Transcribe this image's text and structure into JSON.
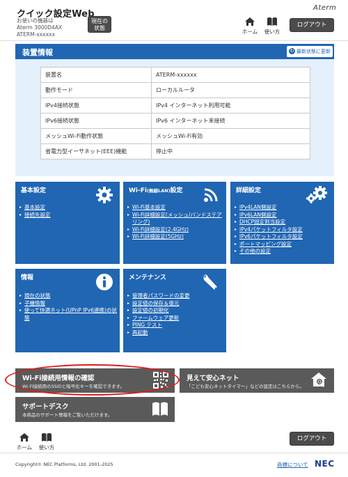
{
  "header": {
    "app_title": "クイック設定Web",
    "model_line1": "お使いの機器は",
    "model_line2": "Aterm 3000D4AX",
    "model_line3": "ATERM-xxxxxx",
    "status_button_line1": "現在の",
    "status_button_line2": "状態",
    "home_label": "ホーム",
    "help_label": "使い方",
    "logout_label": "ログアウト",
    "brand": "Aterm"
  },
  "device_panel": {
    "title": "装置情報",
    "refresh_label": "最新状態に更新",
    "rows": [
      {
        "key": "装置名",
        "value": "ATERM-xxxxxx"
      },
      {
        "key": "動作モード",
        "value": "ローカルルータ"
      },
      {
        "key": "IPv4接続状態",
        "value": "IPv4 インターネット利用可能"
      },
      {
        "key": "IPv6接続状態",
        "value": "IPv6 インターネット未接続"
      },
      {
        "key": "メッシュWi-Fi動作状態",
        "value": "メッシュWi-Fi有効"
      },
      {
        "key": "省電力型イーサネット(EEE)機能",
        "value": "停止中"
      }
    ]
  },
  "tiles": {
    "basic": {
      "title": "基本設定",
      "icon": "gear-icon",
      "links": [
        "基本設定",
        "接続先設定"
      ]
    },
    "wifi": {
      "title": "Wi-Fi",
      "title_small": "(無線LAN)",
      "title_suffix": "設定",
      "icon": "wifi-icon",
      "links": [
        "Wi-Fi基本設定",
        "Wi-Fi詳細設定(メッシュ/バンドステアリング)",
        "Wi-Fi詳細設定(2.4GHz)",
        "Wi-Fi詳細設定(5GHz)"
      ]
    },
    "advanced": {
      "title": "詳細設定",
      "icon": "gears-icon",
      "links": [
        "IPv4LAN側設定",
        "IPv6LAN側設定",
        "DHCP固定割当設定",
        "IPv4パケットフィルタ設定",
        "IPv6パケットフィルタ設定",
        "ポートマッピング設定",
        "その他の設定"
      ]
    },
    "info": {
      "title": "情報",
      "icon": "info-icon",
      "links": [
        "現在の状態",
        "子機情報",
        "使って快適ネット(UPnP IPv6連携)の状態"
      ]
    },
    "maintenance": {
      "title": "メンテナンス",
      "icon": "wrench-icon",
      "links": [
        "管理者パスワードの変更",
        "設定値の保存＆復元",
        "設定値の初期化",
        "ファームウェア更新",
        "PING テスト",
        "再起動"
      ]
    }
  },
  "bottom_tiles": {
    "wifi_confirm": {
      "title": "Wi-Fi接続用情報の確認",
      "subtitle": "Wi-Fi接続用のSSIDと暗号化キーを確認できます。",
      "icon": "qr-code-icon"
    },
    "safe_net": {
      "title": "見えて安心ネット",
      "subtitle": "「こども安心ネットタイマー」などの設定はこちらから。",
      "icon": "house-search-icon"
    },
    "support": {
      "title": "サポートデスク",
      "subtitle": "本商品のサポート情報をご覧いただけます。",
      "icon": "book-icon"
    }
  },
  "footer": {
    "home_label": "ホーム",
    "help_label": "使い方",
    "logout_label": "ログアウト",
    "copyright": "Copyright© NEC Platforms, Ltd. 2001-2025",
    "trademark_link": "商標について",
    "nec_logo": "NEC"
  },
  "colors": {
    "tile_blue": "#2066b3",
    "panel_bg": "#e4f0fb",
    "gray_tile": "#5a5a5a",
    "highlight_red": "#e01b1b"
  }
}
